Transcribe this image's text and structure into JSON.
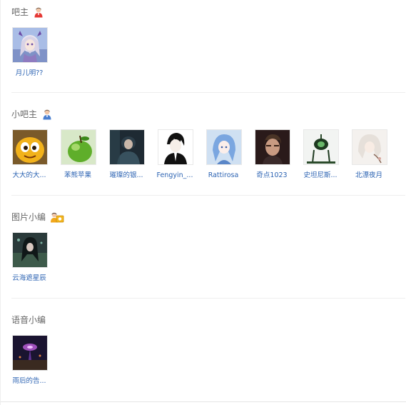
{
  "sections": [
    {
      "title": "吧主",
      "icon": "red-user-icon",
      "members": [
        {
          "name": "月儿明??"
        }
      ]
    },
    {
      "title": "小吧主",
      "icon": "blue-user-icon",
      "members": [
        {
          "name": "大大的大..."
        },
        {
          "name": "苯熊苹果"
        },
        {
          "name": "璀璨的银..."
        },
        {
          "name": "Fengyin_..."
        },
        {
          "name": "Rattirosa"
        },
        {
          "name": "奇点1023"
        },
        {
          "name": "史坦尼斯..."
        },
        {
          "name": "北漂夜月"
        }
      ]
    },
    {
      "title": "图片小编",
      "icon": "photo-editor-icon",
      "members": [
        {
          "name": "云海遮星辰"
        }
      ]
    },
    {
      "title": "语音小编",
      "icon": "",
      "members": [
        {
          "name": "雨后的告..."
        }
      ]
    }
  ]
}
